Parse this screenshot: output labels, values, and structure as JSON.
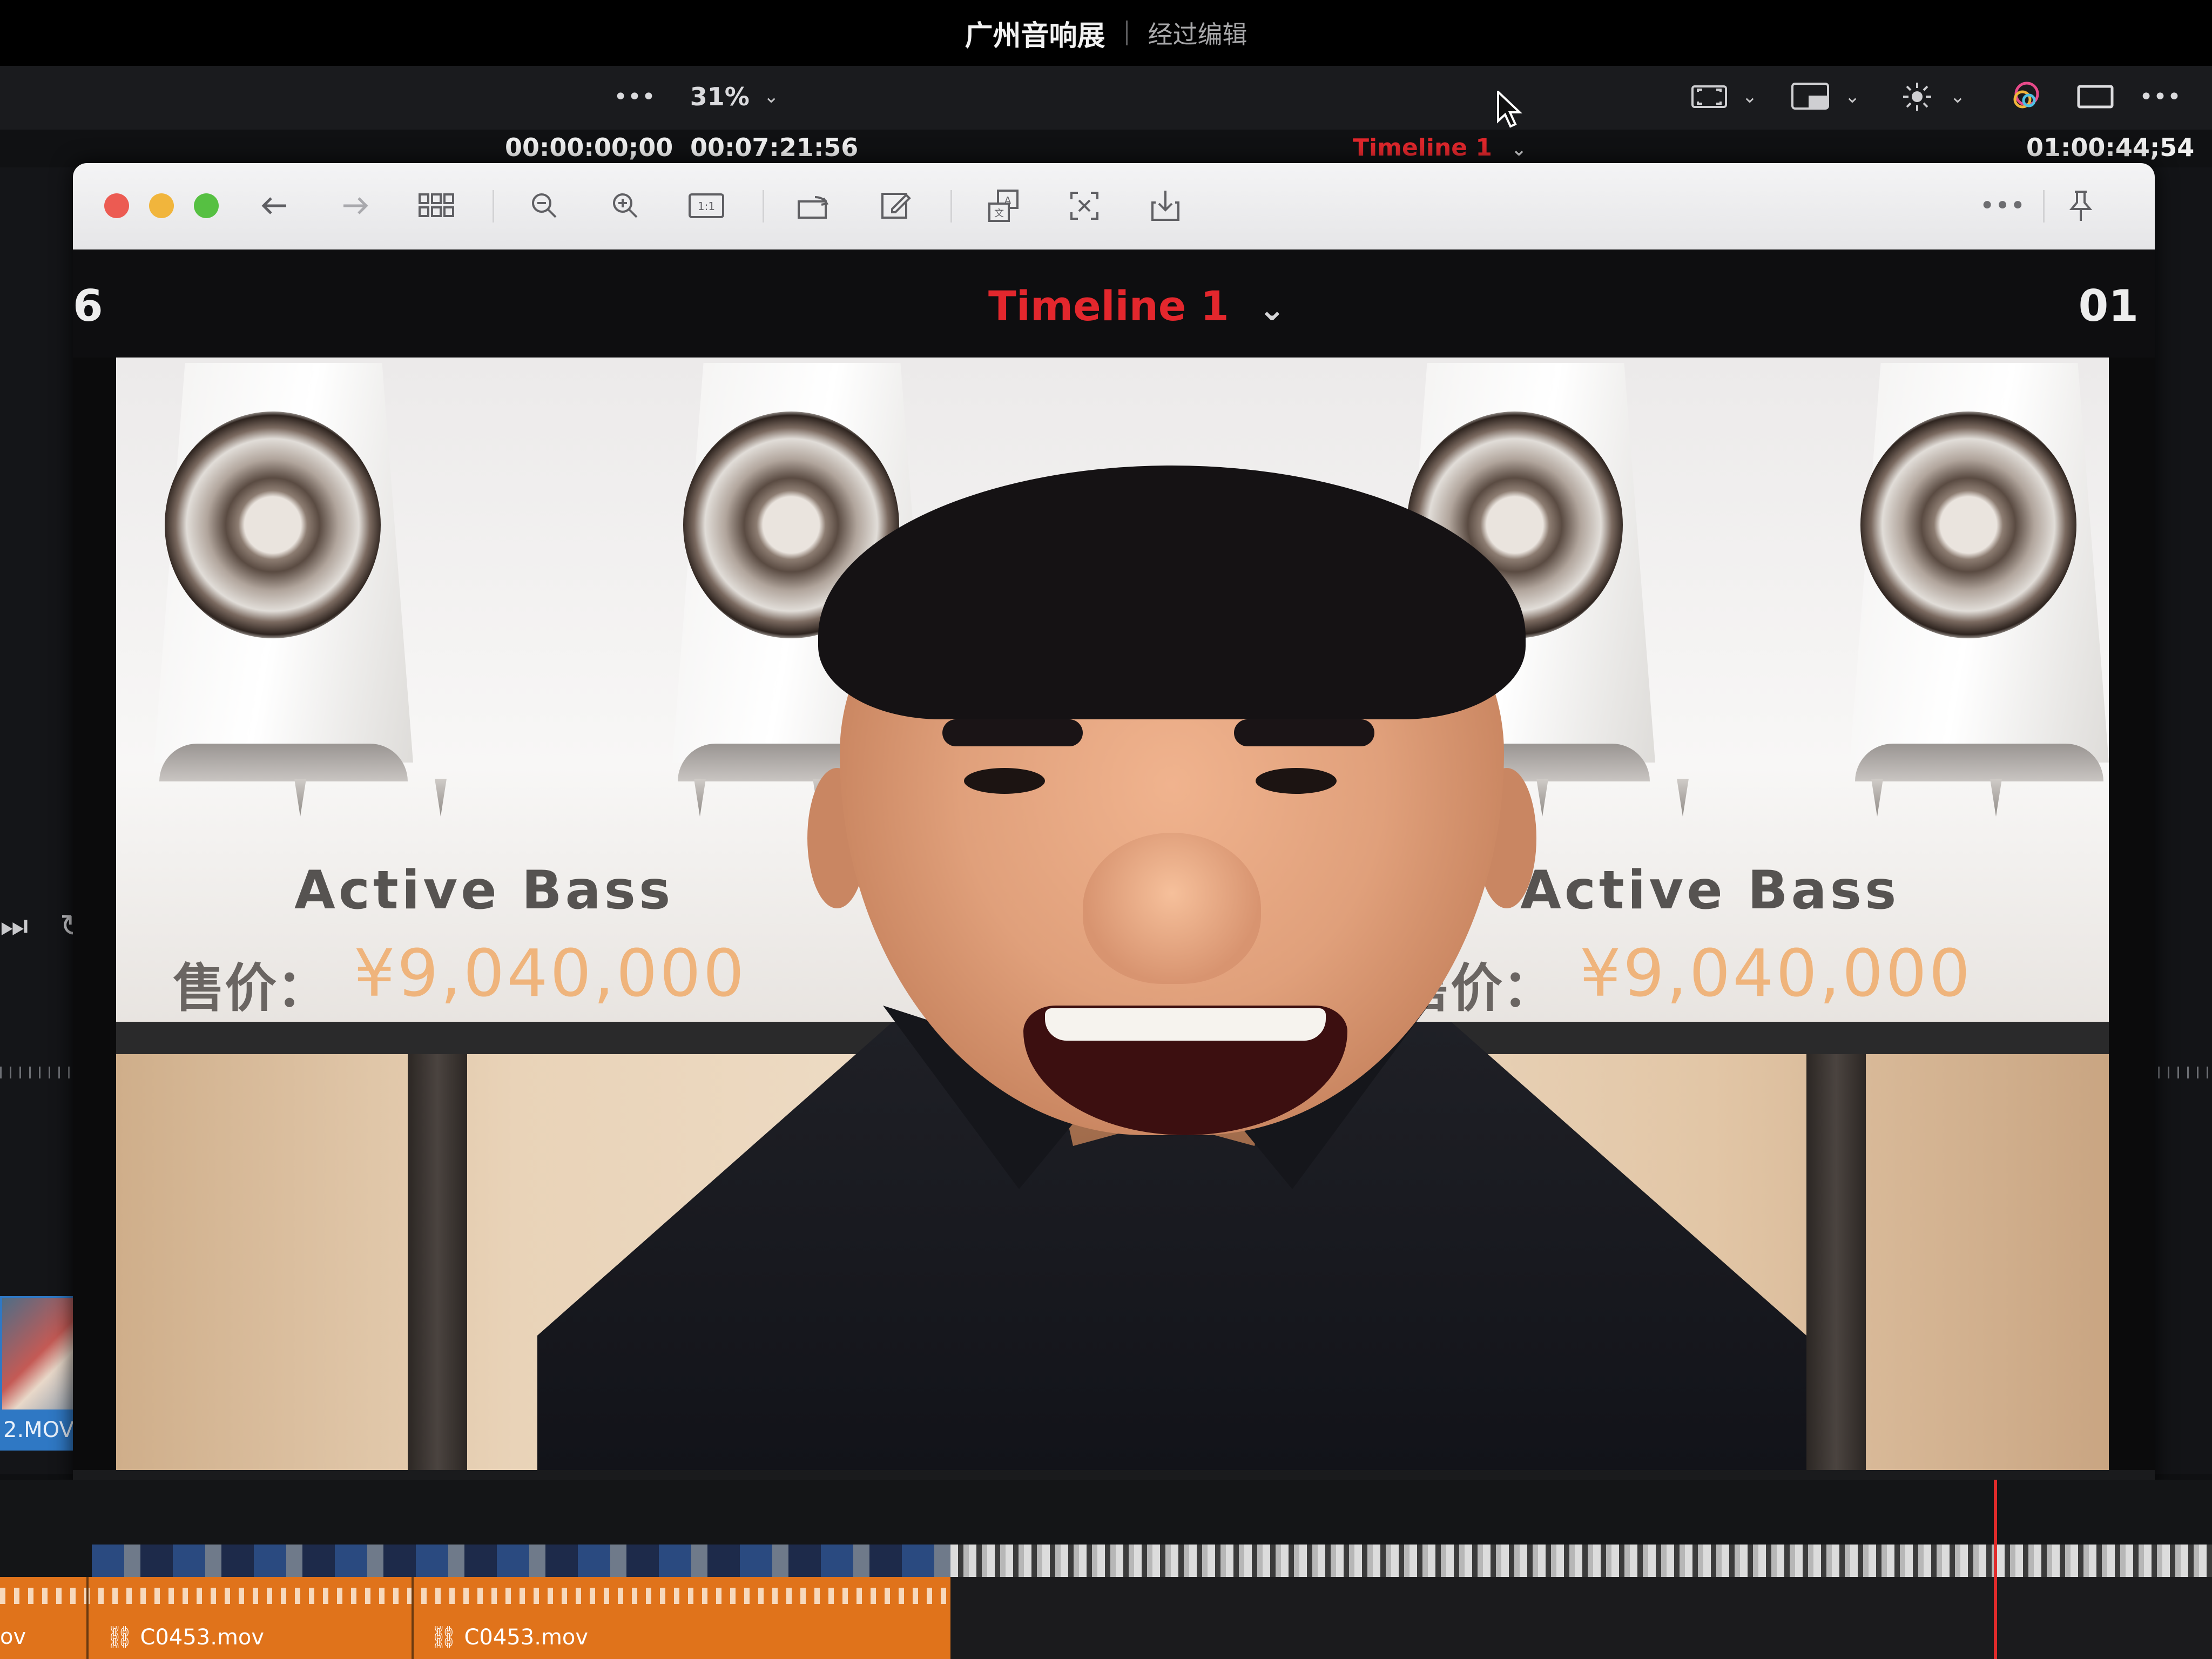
{
  "app": {
    "title": "广州音响展",
    "subtitle": "经过编辑"
  },
  "viewer_toolbar": {
    "more_label": "•••",
    "zoom": "31%",
    "chevron": "⌄"
  },
  "timecodes": {
    "left": "00:00:00;00",
    "duration": "00:07:21:56",
    "timeline_name": "Timeline 1",
    "right": "01:00:44;54"
  },
  "preview_window": {
    "more_label": "•••"
  },
  "inner_viewer": {
    "timeline_name": "Timeline 1",
    "tc_left_fragment": "6",
    "tc_right_fragment": "01"
  },
  "banner": {
    "left": {
      "title": "Active Bass",
      "price_label": "售价：",
      "price_value": "¥9,040,000"
    },
    "right": {
      "title": "Active Bass",
      "price_label": "售价：",
      "price_value": "¥9,040,000"
    }
  },
  "timeline": {
    "left_clip_label": "2.MOV",
    "audio_clip_left_partial": "ov",
    "audio_clip_1": "C0453.mov",
    "audio_clip_2": "C0453.mov"
  },
  "colors": {
    "timeline_red": "#e0272c",
    "audio_orange": "#e0731b",
    "clip_blue": "#2f78c4"
  }
}
